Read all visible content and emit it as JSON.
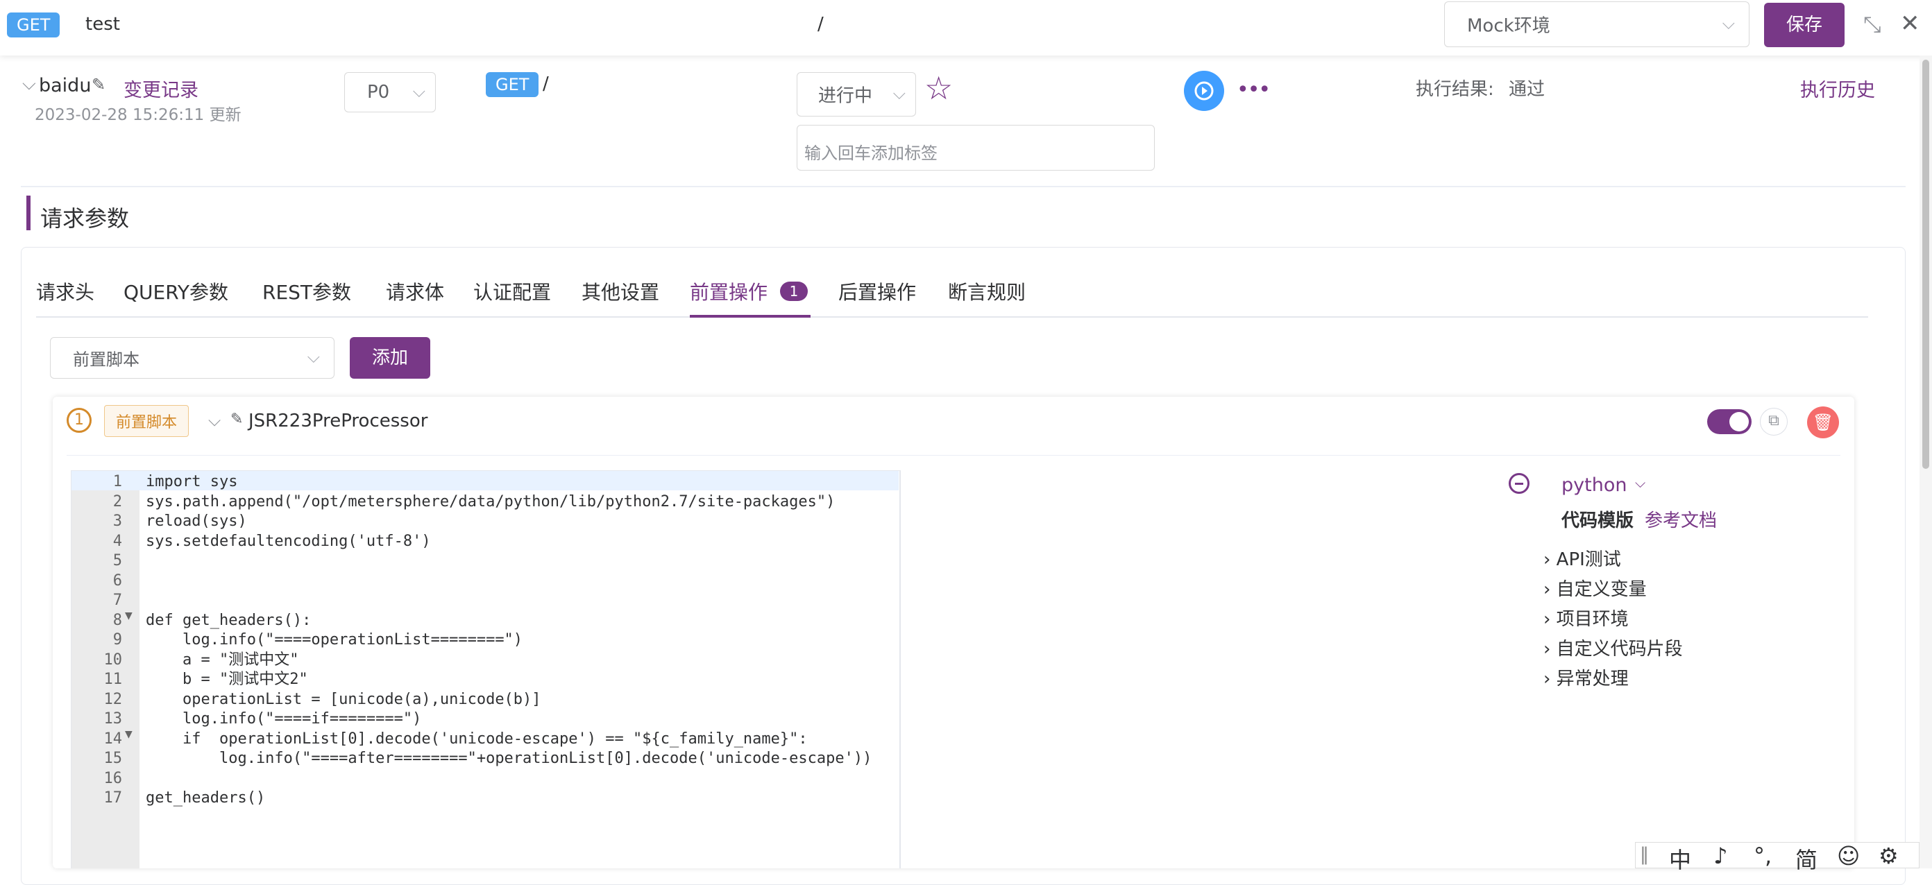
{
  "header": {
    "method": "GET",
    "name": "test",
    "path": "/",
    "environment": "Mock环境",
    "save_label": "保存"
  },
  "case": {
    "name": "baidu",
    "change_log": "变更记录",
    "updated": "2023-02-28 15:26:11 更新",
    "priority": "P0",
    "method": "GET",
    "path": "/",
    "status": "进行中",
    "tag_placeholder": "输入回车添加标签",
    "result_label": "执行结果:",
    "result_value": "通过",
    "history": "执行历史"
  },
  "section_title": "请求参数",
  "tabs": [
    {
      "label": "请求头"
    },
    {
      "label": "QUERY参数"
    },
    {
      "label": "REST参数"
    },
    {
      "label": "请求体"
    },
    {
      "label": "认证配置"
    },
    {
      "label": "其他设置"
    },
    {
      "label": "前置操作",
      "badge": "1",
      "active": true
    },
    {
      "label": "后置操作"
    },
    {
      "label": "断言规则"
    }
  ],
  "pre_ops": {
    "select_value": "前置脚本",
    "add_label": "添加",
    "item_index": "1",
    "item_tag": "前置脚本",
    "item_name": "JSR223PreProcessor"
  },
  "code": {
    "line_numbers": [
      "1",
      "2",
      "3",
      "4",
      "5",
      "6",
      "7",
      "8",
      "9",
      "10",
      "11",
      "12",
      "13",
      "14",
      "15",
      "16",
      "17"
    ],
    "lines": [
      "import sys",
      "sys.path.append(\"/opt/metersphere/data/python/lib/python2.7/site-packages\")",
      "reload(sys)",
      "sys.setdefaultencoding('utf-8')",
      "",
      "",
      "",
      "def get_headers():",
      "    log.info(\"====operationList========\")",
      "    a = \"测试中文\"",
      "    b = \"测试中文2\"",
      "    operationList = [unicode(a),unicode(b)]",
      "    log.info(\"====if========\")",
      "    if  operationList[0].decode('unicode-escape') == \"${c_family_name}\":",
      "        log.info(\"====after========\"+operationList[0].decode('unicode-escape'))",
      "",
      "get_headers()"
    ]
  },
  "script_panel": {
    "language": "python",
    "template_label": "代码模版",
    "docs_label": "参考文档",
    "items": [
      {
        "label": "API测试"
      },
      {
        "label": "自定义变量"
      },
      {
        "label": "项目环境"
      },
      {
        "label": "自定义代码片段"
      },
      {
        "label": "异常处理"
      }
    ]
  },
  "ime_bar": {
    "items": [
      "中",
      "♪",
      "°,",
      "简",
      "☺",
      "⚙"
    ]
  },
  "colors": {
    "accent": "#783887",
    "method": "#4da3f0",
    "run": "#409eff",
    "delete": "#f56c6c"
  }
}
